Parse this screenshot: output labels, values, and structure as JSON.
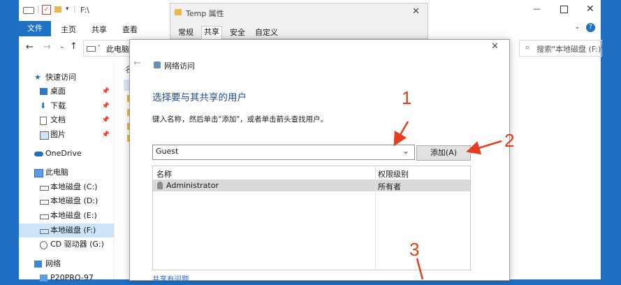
{
  "explorer": {
    "path_title": "F:\\",
    "ribbon": {
      "file": "文件",
      "home": "主页",
      "share": "共享",
      "view": "查看"
    },
    "address": {
      "location": "此电脑",
      "search_placeholder": "搜索\"本地磁盘 (F:)\""
    },
    "nav": {
      "quick_access": "快速访问",
      "desktop": "桌面",
      "downloads": "下载",
      "documents": "文档",
      "pictures": "图片",
      "onedrive": "OneDrive",
      "this_pc": "此电脑",
      "drive_c": "本地磁盘 (C:)",
      "drive_d": "本地磁盘 (D:)",
      "drive_e": "本地磁盘 (E:)",
      "drive_f": "本地磁盘 (F:)",
      "drive_g": "CD 驱动器 (G:)",
      "network": "网络",
      "network_pc": "P20PRO-97"
    },
    "content_header_partial": "名"
  },
  "properties": {
    "title": "Temp 属性",
    "tabs": [
      "常规",
      "共享",
      "安全",
      "自定义"
    ]
  },
  "dialog": {
    "header_title": "网络访问",
    "heading": "选择要与其共享的用户",
    "instruction": "键入名称，然后单击\"添加\"，或者单击箭头查找用户。",
    "input_value": "Guest",
    "add_button": "添加(A)",
    "columns": {
      "name": "名称",
      "permission": "权限级别"
    },
    "rows": [
      {
        "name": "Administrator",
        "permission": "所有者"
      }
    ],
    "help_link": "共享有问题"
  },
  "annotations": [
    "1",
    "2",
    "3"
  ],
  "colors": {
    "accent": "#1e72c4",
    "annotation": "#e53d1d",
    "desktop": "#1f6fc4"
  }
}
